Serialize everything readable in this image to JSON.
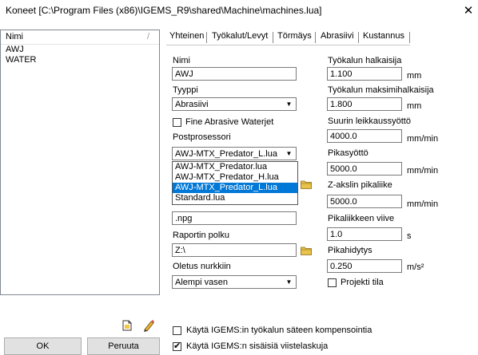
{
  "window": {
    "title": "Koneet  [C:\\Program Files (x86)\\IGEMS_R9\\shared\\Machine\\machines.lua]",
    "close_glyph": "✕"
  },
  "list": {
    "header": "Nimi",
    "header_sep": "/",
    "items": [
      "AWJ",
      "WATER"
    ]
  },
  "tabs": [
    "Yhteinen",
    "Työkalut/Levyt",
    "Törmäys",
    "Abrasiivi",
    "Kustannus"
  ],
  "left_form": {
    "nimi_label": "Nimi",
    "nimi_value": "AWJ",
    "tyyppi_label": "Tyyppi",
    "tyyppi_value": "Abrasiivi",
    "fine_abrasive_label": "Fine Abrasive Waterjet",
    "post_label": "Postprosessori",
    "post_value": "AWJ-MTX_Predator_L.lua",
    "post_options": [
      "AWJ-MTX_Predator.lua",
      "AWJ-MTX_Predator_H.lua",
      "AWJ-MTX_Predator_L.lua",
      "Standard.lua"
    ],
    "post_selected_index": 2,
    "ext_value": ".npg",
    "raportin_label": "Raportin polku",
    "raportin_value": "Z:\\",
    "oletus_label": "Oletus nurkkiin",
    "oletus_value": "Alempi vasen"
  },
  "right_form": {
    "halkaisija_label": "Työkalun halkaisija",
    "halkaisija_value": "1.100",
    "halkaisija_unit": "mm",
    "maksimi_label": "Työkalun maksimihalkaisija",
    "maksimi_value": "1.800",
    "maksimi_unit": "mm",
    "syotto_label": "Suurin leikkaussyöttö",
    "syotto_value": "4000.0",
    "syotto_unit": "mm/min",
    "pika_label": "Pikasyöttö",
    "pika_value": "5000.0",
    "pika_unit": "mm/min",
    "z_label": "Z-akslin pikaliike",
    "z_value": "5000.0",
    "z_unit": "mm/min",
    "viive_label": "Pikaliikkeen viive",
    "viive_value": "1.0",
    "viive_unit": "s",
    "hidytys_label": "Pikahidytys",
    "hidytys_value": "0.250",
    "hidytys_unit": "m/s²",
    "projekti_label": "Projekti tila"
  },
  "bottom": {
    "kompensointi_label": "Käytä IGEMS:in työkalun säteen kompensointia",
    "viistelaskuja_label": "Käytä IGEMS:n sisäisiä viistelaskuja",
    "ok_label": "OK",
    "cancel_label": "Peruuta"
  },
  "icons": {
    "new": "new-document-icon",
    "edit": "edit-pencil-icon",
    "folder": "folder-icon"
  }
}
